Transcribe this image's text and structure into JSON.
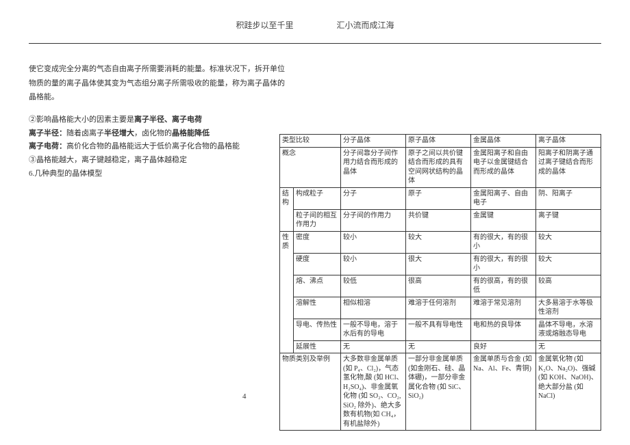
{
  "header": {
    "left": "积跬步以至千里",
    "right": "汇小流而成江海"
  },
  "intro": {
    "l1": "使它变成完全分离的气态自由离子所需要消耗的能量。标准状况下，拆开单位",
    "l2": "物质的量的离子晶体使其变为气态组分离子所需吸收的能量，称为离子晶体的",
    "l3": "晶格能。"
  },
  "sec2": {
    "p1a": "②影响晶格能大小的因素主要是",
    "p1b": "离子半径、离子电荷",
    "p2a": "离子半径：",
    "p2b": "随着卤离子",
    "p2c": "半径增大",
    "p2d": "，卤化物的",
    "p2e": "晶格能降低",
    "p3a": "离子电荷：",
    "p3b": "高价化合物的晶格能远大于低价离子化合物的晶格能",
    "p4": "③晶格能越大，离子键越稳定，离子晶体越稳定",
    "p5": "6.几种典型的晶体模型"
  },
  "tbl": {
    "h1": "类型比较",
    "h2": "分子晶体",
    "h3": "原子晶体",
    "h4": "金属晶体",
    "h5": "离子晶体",
    "r1c0": "概念",
    "r1c1": "分子间靠分子间作用力结合而形成的晶体",
    "r1c2": "原子之间以共价键结合而形成的具有空间网状结构的晶体",
    "r1c3": "金属阳离子和自由电子以金属键结合而形成的晶体",
    "r1c4": "阳离子和阴离子通过离子键结合而形成的晶体",
    "g1": "结构",
    "r2c0": "构成粒子",
    "r2c1": "分子",
    "r2c2": "原子",
    "r2c3": "金属阳离子、自由电子",
    "r2c4": "阴、阳离子",
    "r3c0": "粒子间的相互作用力",
    "r3c1": "分子间的作用力",
    "r3c2": "共价键",
    "r3c3": "金属键",
    "r3c4": "离子键",
    "g2": "性质",
    "r4c0": "密度",
    "r4c1": "较小",
    "r4c2": "较大",
    "r4c3": "有的很大，有的很小",
    "r4c4": "较大",
    "r5c0": "硬度",
    "r5c1": "较小",
    "r5c2": "很大",
    "r5c3": "有的很大，有的很小",
    "r5c4": "较大",
    "r6c0": "熔、沸点",
    "r6c1": "较低",
    "r6c2": "很高",
    "r6c3": "有的很高，有的很低",
    "r6c4": "较高",
    "r7c0": "溶解性",
    "r7c1": "相似相溶",
    "r7c2": "难溶于任何溶剂",
    "r7c3": "难溶于常见溶剂",
    "r7c4": "大多易溶于水等极性溶剂",
    "r8c0": "导电、传热性",
    "r8c1": "一般不导电，溶于水后有的导电",
    "r8c2": "一般不具有导电性",
    "r8c3": "电和热的良导体",
    "r8c4": "晶体不导电，水溶液或熔融态导电",
    "r9c0": "延展性",
    "r9c1": "无",
    "r9c2": "无",
    "r9c3": "良好",
    "r9c4": "无",
    "r10c0": "物质类别及举例",
    "r10c1": "大多数非金属单质 (如 P₄、Cl₂)，气态氢化物,酸 (如 HCl、H₂SO₄)、非金属氧化物 (如 SO₂、CO₂, SiO₂ 除外)、绝大多数有机物(如 CH₄，有机盐除外)",
    "r10c2": "一部分非金属单质(如金刚石、硅、晶体硼)，一部分非金属化合物 (如 SiC、SiO₂)",
    "r10c3": "金属单质与合金 (如 Na、Al、Fe、青铜)",
    "r10c4": "金属氧化物 (如 K₂O、Na₂O)、强碱 (如 KOH、NaOH)、绝大部分盐 (如 NaCl)"
  },
  "pagenum": "4"
}
